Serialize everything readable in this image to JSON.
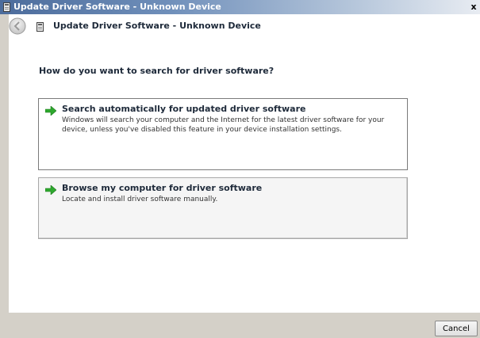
{
  "window": {
    "title": "Update Driver Software - Unknown Device",
    "close_label": "x"
  },
  "nav": {
    "wizard_title": "Update Driver Software - Unknown Device"
  },
  "question": "How do you want to search for driver software?",
  "options": [
    {
      "title": "Search automatically for updated driver software",
      "description": "Windows will search your computer and the Internet for the latest driver software for your device, unless you've disabled this feature in your device installation settings."
    },
    {
      "title": "Browse my computer for driver software",
      "description": "Locate and install driver software manually."
    }
  ],
  "footer": {
    "cancel_label": "Cancel"
  },
  "colors": {
    "arrow_green": "#2ea82e",
    "title_bar_start": "#4c6c9c",
    "dialog_bg": "#d4d0c8"
  },
  "icons": {
    "title_icon": "device-driver-icon",
    "back_icon": "back-arrow-icon",
    "option_icon": "green-arrow-icon"
  }
}
